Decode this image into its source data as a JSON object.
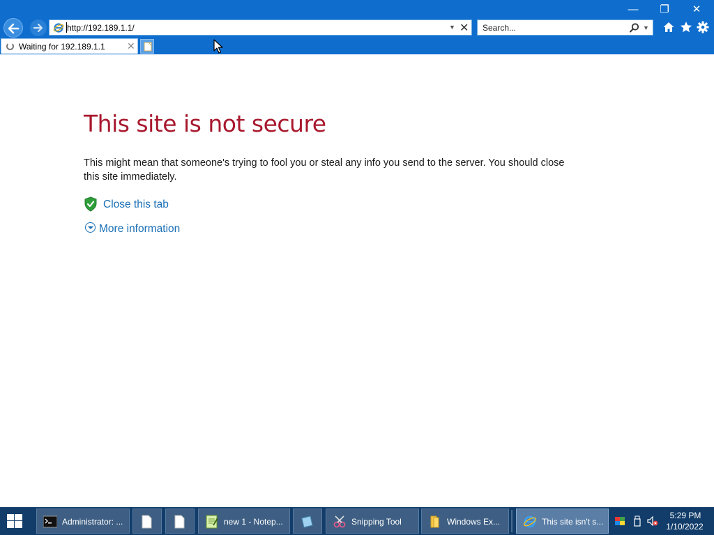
{
  "window": {
    "minimize_glyph": "—",
    "maximize_glyph": "❐",
    "close_glyph": "✕"
  },
  "navigation": {
    "back_icon": "back-arrow-icon",
    "forward_icon": "forward-arrow-icon"
  },
  "address_bar": {
    "url": "http://192.189.1.1/",
    "dropdown_glyph": "▼",
    "stop_glyph": "✕"
  },
  "search": {
    "placeholder": "Search...",
    "dropdown_glyph": "▼"
  },
  "tabs": [
    {
      "label": "Waiting for 192.189.1.1",
      "close_glyph": "✕",
      "loading": true
    }
  ],
  "page": {
    "title": "This site is not secure",
    "description": "This might mean that someone's trying to fool you or steal any info you send to the server. You should close this site immediately.",
    "close_tab_label": "Close this tab",
    "more_info_label": "More information"
  },
  "taskbar": {
    "items": [
      {
        "label": "Administrator: ...",
        "icon": "command-prompt-icon"
      },
      {
        "label": "",
        "icon": "blank-document-icon"
      },
      {
        "label": "",
        "icon": "blank-document-icon"
      },
      {
        "label": "new 1 - Notep...",
        "icon": "notepad-plus-icon"
      },
      {
        "label": "",
        "icon": "sticky-note-icon"
      },
      {
        "label": "Snipping Tool",
        "icon": "snipping-tool-icon"
      },
      {
        "label": "Windows Ex...",
        "icon": "folder-icon"
      },
      {
        "label": "This site isn't s...",
        "icon": "internet-explorer-icon",
        "active": true
      }
    ],
    "clock": {
      "time": "5:29 PM",
      "date": "1/10/2022"
    }
  },
  "colors": {
    "chrome_blue": "#0f6ecd",
    "title_red": "#a8182d",
    "link_blue": "#1a6fb5",
    "taskbar": "#123d6a"
  }
}
